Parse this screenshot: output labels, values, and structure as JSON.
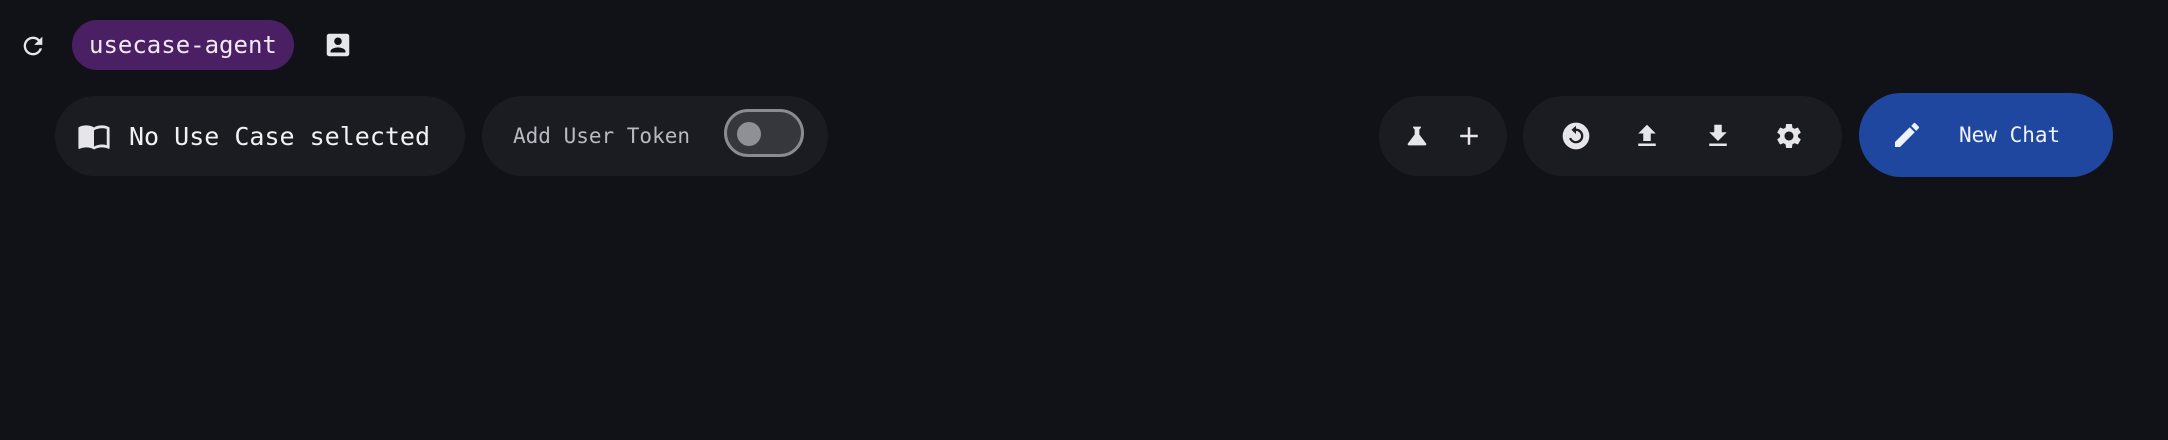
{
  "top": {
    "agent_chip": "usecase-agent",
    "refresh_icon": "refresh-icon",
    "profile_icon": "contact-card-icon"
  },
  "usecase": {
    "label": "No Use Case selected",
    "icon": "book-open-icon"
  },
  "token": {
    "label": "Add User Token",
    "toggle_on": false
  },
  "tools": [
    {
      "icon": "flask-icon"
    },
    {
      "icon": "plus-icon"
    }
  ],
  "actions": [
    {
      "icon": "history-icon"
    },
    {
      "icon": "upload-icon"
    },
    {
      "icon": "download-icon"
    },
    {
      "icon": "settings-gear-icon"
    }
  ],
  "new_chat": {
    "label": "New Chat",
    "icon": "pencil-icon"
  },
  "colors": {
    "background": "#111217",
    "pill": "#1b1c22",
    "agent_chip": "#4b1f63",
    "primary": "#1f47a0"
  }
}
